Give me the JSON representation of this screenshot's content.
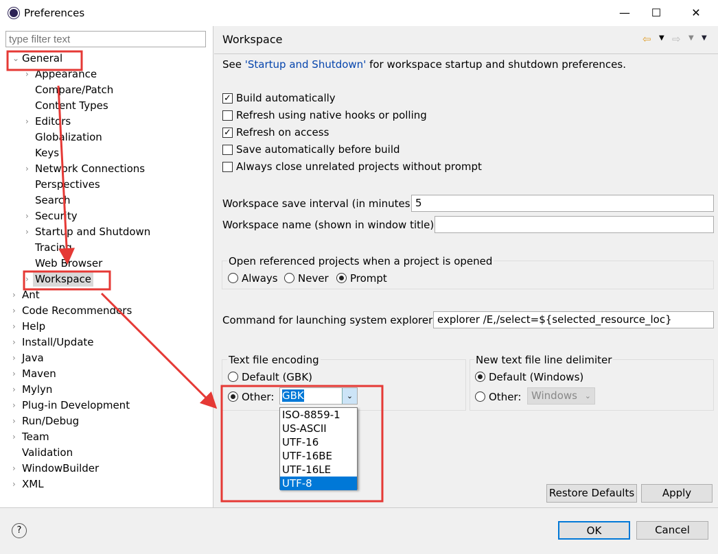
{
  "window": {
    "title": "Preferences",
    "minimize": "—",
    "maximize": "☐",
    "close": "✕"
  },
  "filter": {
    "placeholder": "type filter text"
  },
  "tree": [
    {
      "label": "General",
      "level": 0,
      "expanded": true
    },
    {
      "label": "Appearance",
      "level": 1,
      "children": true
    },
    {
      "label": "Compare/Patch",
      "level": 1
    },
    {
      "label": "Content Types",
      "level": 1
    },
    {
      "label": "Editors",
      "level": 1,
      "children": true
    },
    {
      "label": "Globalization",
      "level": 1
    },
    {
      "label": "Keys",
      "level": 1
    },
    {
      "label": "Network Connections",
      "level": 1,
      "children": true
    },
    {
      "label": "Perspectives",
      "level": 1
    },
    {
      "label": "Search",
      "level": 1
    },
    {
      "label": "Security",
      "level": 1,
      "children": true
    },
    {
      "label": "Startup and Shutdown",
      "level": 1,
      "children": true
    },
    {
      "label": "Tracing",
      "level": 1
    },
    {
      "label": "Web Browser",
      "level": 1
    },
    {
      "label": "Workspace",
      "level": 1,
      "children": true,
      "selected": true
    },
    {
      "label": "Ant",
      "level": 0,
      "children": true
    },
    {
      "label": "Code Recommenders",
      "level": 0,
      "children": true
    },
    {
      "label": "Help",
      "level": 0,
      "children": true
    },
    {
      "label": "Install/Update",
      "level": 0,
      "children": true
    },
    {
      "label": "Java",
      "level": 0,
      "children": true
    },
    {
      "label": "Maven",
      "level": 0,
      "children": true
    },
    {
      "label": "Mylyn",
      "level": 0,
      "children": true
    },
    {
      "label": "Plug-in Development",
      "level": 0,
      "children": true
    },
    {
      "label": "Run/Debug",
      "level": 0,
      "children": true
    },
    {
      "label": "Team",
      "level": 0,
      "children": true
    },
    {
      "label": "Validation",
      "level": 0
    },
    {
      "label": "WindowBuilder",
      "level": 0,
      "children": true
    },
    {
      "label": "XML",
      "level": 0,
      "children": true
    }
  ],
  "page": {
    "title": "Workspace",
    "see_prefix": "See ",
    "see_link": "'Startup and Shutdown'",
    "see_suffix": " for workspace startup and shutdown preferences.",
    "checkboxes": [
      {
        "label": "Build automatically",
        "checked": true
      },
      {
        "label": "Refresh using native hooks or polling",
        "checked": false
      },
      {
        "label": "Refresh on access",
        "checked": true
      },
      {
        "label": "Save automatically before build",
        "checked": false
      },
      {
        "label": "Always close unrelated projects without prompt",
        "checked": false
      }
    ],
    "save_interval_label": "Workspace save interval (in minutes):",
    "save_interval_value": "5",
    "ws_name_label": "Workspace name (shown in window title):",
    "ws_name_value": "",
    "open_ref_label": "Open referenced projects when a project is opened",
    "open_ref_options": [
      "Always",
      "Never",
      "Prompt"
    ],
    "open_ref_selected": "Prompt",
    "explorer_label": "Command for launching system explorer:",
    "explorer_value": "explorer /E,/select=${selected_resource_loc}",
    "encoding": {
      "label": "Text file encoding",
      "default_label": "Default (GBK)",
      "other_label": "Other:",
      "other_value": "GBK",
      "options": [
        "ISO-8859-1",
        "US-ASCII",
        "UTF-16",
        "UTF-16BE",
        "UTF-16LE",
        "UTF-8"
      ],
      "highlighted": "UTF-8"
    },
    "delimiter": {
      "label": "New text file line delimiter",
      "default_label": "Default (Windows)",
      "other_label": "Other:",
      "other_value": "Windows"
    },
    "restore_defaults": "Restore Defaults",
    "apply": "Apply"
  },
  "footer": {
    "ok": "OK",
    "cancel": "Cancel",
    "help_icon": "?"
  },
  "annotation_color": "#e53935"
}
